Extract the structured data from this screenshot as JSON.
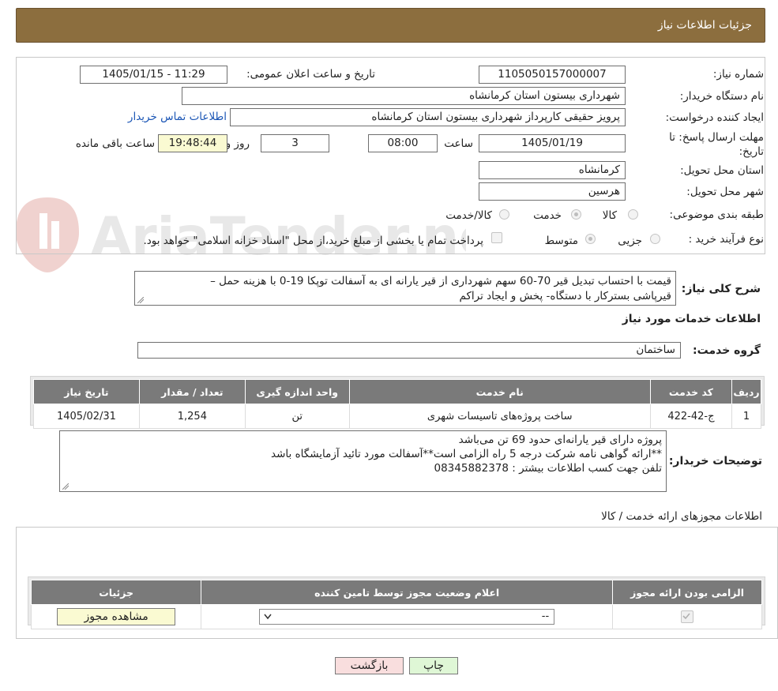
{
  "header": {
    "title": "جزئیات اطلاعات نیاز"
  },
  "watermark": {
    "text": "AriaTender.neT"
  },
  "form": {
    "need_number": {
      "label": "شماره نیاز:",
      "value": "1105050157000007"
    },
    "announce": {
      "label": "تاریخ و ساعت اعلان عمومی:",
      "value": "1405/01/15 - 11:29"
    },
    "buyer_org": {
      "label": "نام دستگاه خریدار:",
      "value": "شهرداری بیستون استان کرمانشاه"
    },
    "requester": {
      "label": "ایجاد کننده درخواست:",
      "value": "پرویز حقیقی کارپرداز شهرداری بیستون استان کرمانشاه",
      "contact_link": "اطلاعات تماس خریدار"
    },
    "deadline": {
      "label_line1": "مهلت ارسال پاسخ: تا",
      "label_line2": "تاریخ:",
      "date": "1405/01/19",
      "time_label": "ساعت",
      "time": "08:00",
      "days": "3",
      "days_label": "روز و",
      "remaining": "19:48:44",
      "remaining_label": "ساعت باقی مانده"
    },
    "province": {
      "label": "استان محل تحویل:",
      "value": "کرمانشاه"
    },
    "city": {
      "label": "شهر محل تحویل:",
      "value": "هرسین"
    },
    "category": {
      "label": "طبقه بندی موضوعی:",
      "options": [
        "کالا",
        "خدمت",
        "کالا/خدمت"
      ],
      "selected": "خدمت"
    },
    "process": {
      "label": "نوع فرآیند خرید :",
      "options": [
        "جزیی",
        "متوسط"
      ],
      "selected": "متوسط",
      "payment_note": "پرداخت تمام یا بخشی از مبلغ خرید،از محل \"اسناد خزانه اسلامی\" خواهد بود."
    }
  },
  "summary": {
    "label": "شرح کلی نیاز:",
    "line1": "قیمت با احتساب  تبدیل قیر 70-60  سهم شهرداری از قیر یارانه ای به آسفالت توپکا 19-0 با هزینه حمل –",
    "line2": "قیرپاشی بسترکار با دستگاه- پخش و ایجاد تراکم"
  },
  "services": {
    "section_title": "اطلاعات خدمات مورد نیاز",
    "group_label": "گروه خدمت:",
    "group_value": "ساختمان",
    "columns": [
      "ردیف",
      "کد خدمت",
      "نام خدمت",
      "واحد اندازه گیری",
      "تعداد / مقدار",
      "تاریخ نیاز"
    ],
    "rows": [
      {
        "row": "1",
        "code": "ج-42-422",
        "name": "ساخت پروژه‌های تاسیسات شهری",
        "unit": "تن",
        "qty": "1,254",
        "date": "1405/02/31"
      }
    ]
  },
  "buyer_notes": {
    "label": "توضیحات خریدار:",
    "line1": "پروژه دارای قیر یارانه‌ای حدود 69 تن می‌باشد",
    "line2": "**ارائه گواهی نامه شرکت درجه 5 راه الزامی است**آسفالت مورد تائید آزمایشگاه باشد",
    "line3": "تلفن جهت کسب اطلاعات بیشتر : 08345882378"
  },
  "permits": {
    "section_title": "اطلاعات مجوزهای ارائه خدمت / کالا",
    "columns": [
      "الزامی بودن ارائه مجوز",
      "اعلام وضعیت مجوز توسط تامین کننده",
      "جزئیات"
    ],
    "select_value": "--",
    "view_button": "مشاهده مجوز"
  },
  "footer": {
    "print_button": "چاپ",
    "back_button": "بازگشت"
  },
  "colors": {
    "header_bg": "#8c6e3e",
    "table_header_bg": "#7a7a7a",
    "back_button_bg": "#f9dede",
    "print_button_bg": "#dff7d6",
    "link": "#1a55b5"
  }
}
